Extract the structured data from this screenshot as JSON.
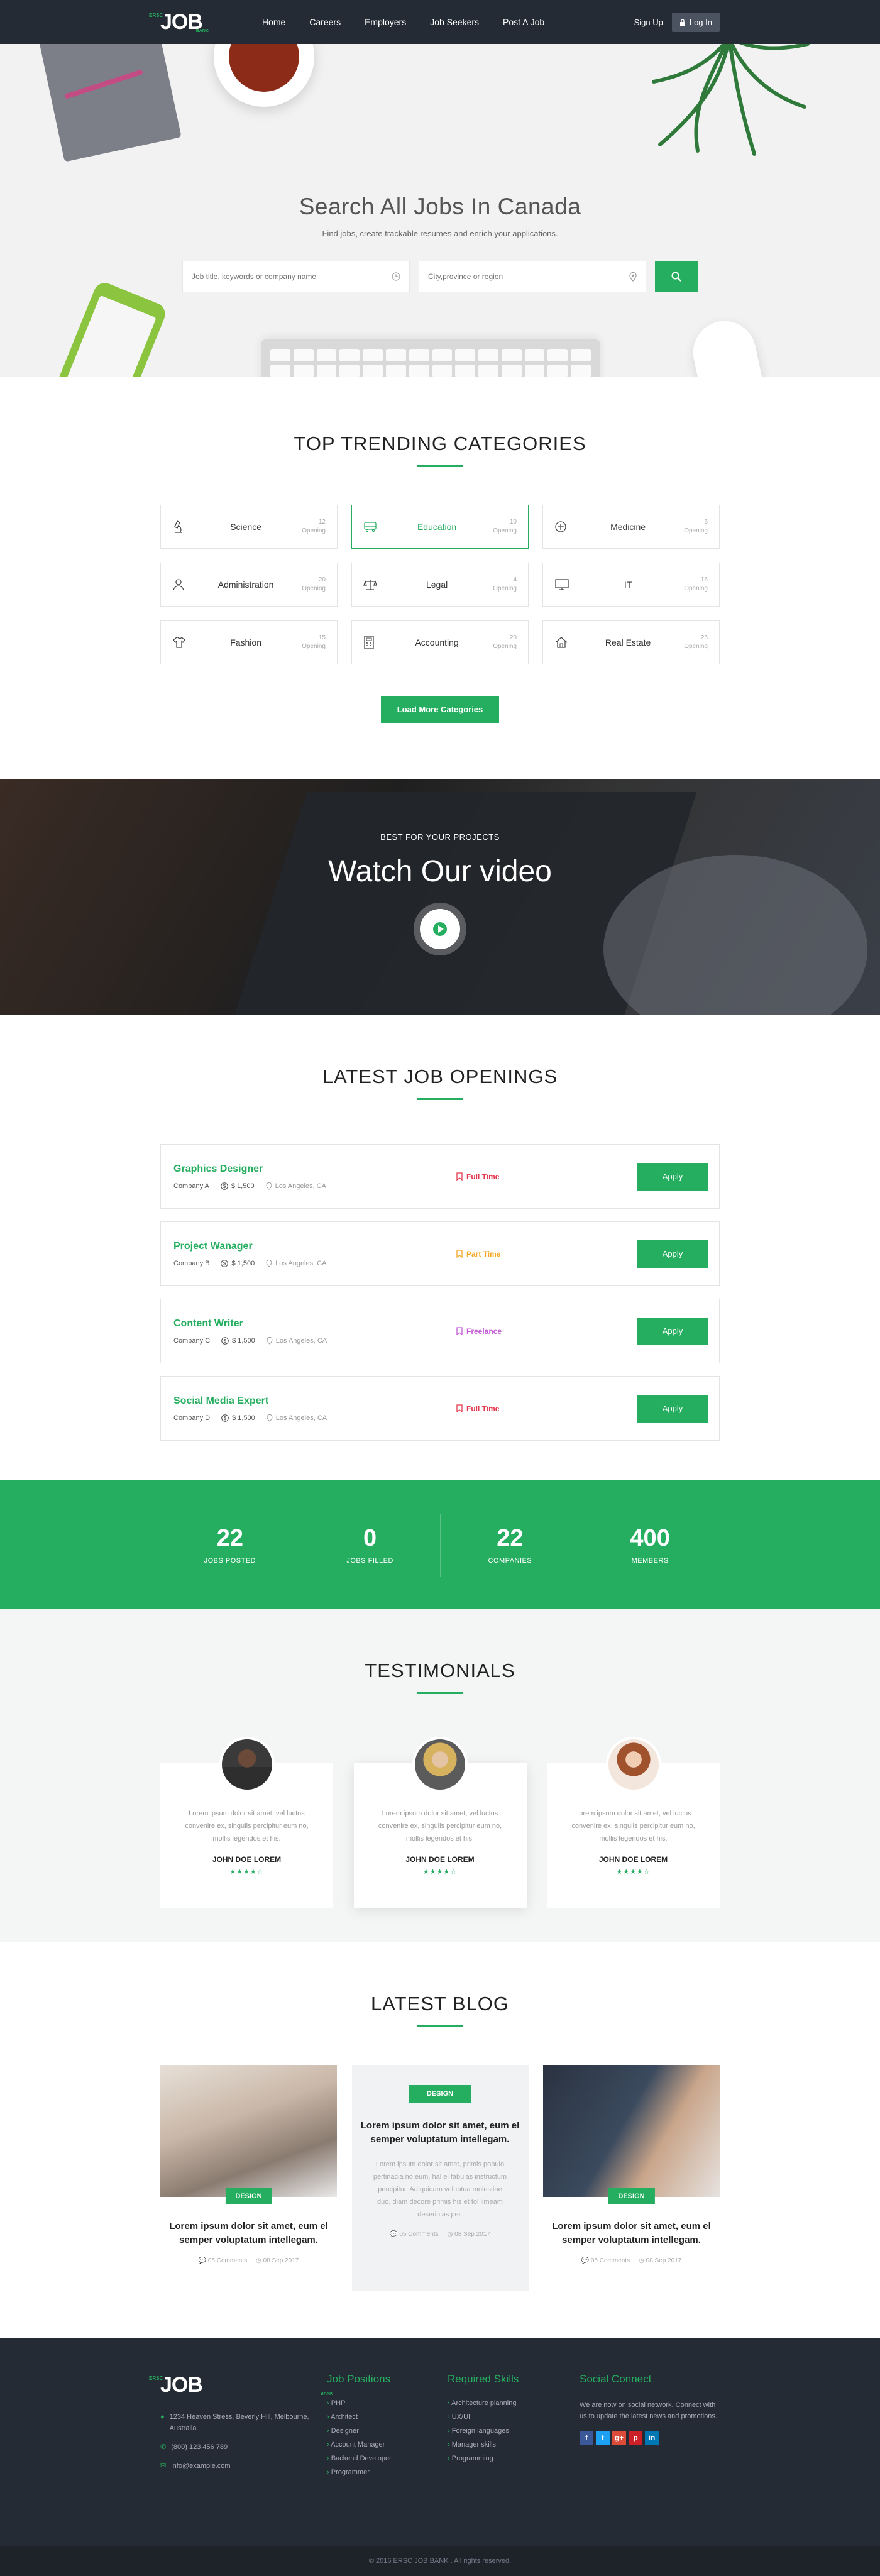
{
  "brand": {
    "logo_main": "JOB",
    "logo_small": "ERSC",
    "logo_sub": "BANK",
    "accent": "#25ae5f",
    "dark": "#252b34"
  },
  "nav": {
    "items": [
      "Home",
      "Careers",
      "Employers",
      "Job Seekers",
      "Post A Job"
    ],
    "signup": "Sign Up",
    "login": "Log In"
  },
  "hero": {
    "title": "Search All Jobs In Canada",
    "subtitle": "Find jobs, create trackable resumes and enrich your applications.",
    "keyword_placeholder": "Job title, keywords or company name",
    "location_placeholder": "City,province or region"
  },
  "categories": {
    "title": "TOP TRENDING CATEGORIES",
    "items": [
      {
        "name": "Science",
        "count": "12",
        "label": "Opening",
        "icon": "microscope-icon"
      },
      {
        "name": "Education",
        "count": "10",
        "label": "Opening",
        "icon": "bus-icon"
      },
      {
        "name": "Medicine",
        "count": "6",
        "label": "Opening",
        "icon": "medical-icon"
      },
      {
        "name": "Administration",
        "count": "20",
        "label": "Opening",
        "icon": "user-icon"
      },
      {
        "name": "Legal",
        "count": "4",
        "label": "Opening",
        "icon": "scale-icon"
      },
      {
        "name": "IT",
        "count": "16",
        "label": "Opening",
        "icon": "monitor-icon"
      },
      {
        "name": "Fashion",
        "count": "15",
        "label": "Opening",
        "icon": "shirt-icon"
      },
      {
        "name": "Accounting",
        "count": "20",
        "label": "Opening",
        "icon": "calculator-icon"
      },
      {
        "name": "Real Estate",
        "count": "26",
        "label": "Opening",
        "icon": "house-icon"
      }
    ],
    "button": "Load More Categories"
  },
  "video": {
    "kicker": "BEST FOR YOUR PROJECTS",
    "title": "Watch Our video"
  },
  "jobs": {
    "title": "LATEST JOB OPENINGS",
    "apply_label": "Apply",
    "items": [
      {
        "title": "Graphics Designer",
        "company": "Company A",
        "salary": "$ 1,500",
        "location": "Los Angeles, CA",
        "type": "Full Time",
        "type_color": "#e2384d"
      },
      {
        "title": "Project Wanager",
        "company": "Company B",
        "salary": "$ 1,500",
        "location": "Los Angeles, CA",
        "type": "Part Time",
        "type_color": "#f5a623"
      },
      {
        "title": "Content Writer",
        "company": "Company C",
        "salary": "$ 1,500",
        "location": "Los Angeles, CA",
        "type": "Freelance",
        "type_color": "#c45ad6"
      },
      {
        "title": "Social Media Expert",
        "company": "Company D",
        "salary": "$ 1,500",
        "location": "Los Angeles, CA",
        "type": "Full Time",
        "type_color": "#e2384d"
      }
    ]
  },
  "stats": [
    {
      "num": "22",
      "label": "JOBS POSTED"
    },
    {
      "num": "0",
      "label": "JOBS FILLED"
    },
    {
      "num": "22",
      "label": "COMPANIES"
    },
    {
      "num": "400",
      "label": "MEMBERS"
    }
  ],
  "testimonials": {
    "title": "TESTIMONIALS",
    "items": [
      {
        "text": "Lorem ipsum dolor sit amet, vel luctus convenire ex, singulis percipitur eum no, mollis legendos et his.",
        "name": "JOHN DOE LOREM",
        "stars": "★★★★☆"
      },
      {
        "text": "Lorem ipsum dolor sit amet, vel luctus convenire ex, singulis percipitur eum no, mollis legendos et his.",
        "name": "JOHN DOE LOREM",
        "stars": "★★★★☆"
      },
      {
        "text": "Lorem ipsum dolor sit amet, vel luctus convenire ex, singulis percipitur eum no, mollis legendos et his.",
        "name": "JOHN DOE LOREM",
        "stars": "★★★★☆"
      }
    ]
  },
  "blog": {
    "title": "LATEST BLOG",
    "posts": [
      {
        "tag": "DESIGN",
        "title": "Lorem ipsum dolor sit amet, eum el semper voluptatum intellegam.",
        "comments": "05 Comments",
        "date": "08 Sep 2017"
      },
      {
        "tag": "DESIGN",
        "title": "Lorem ipsum dolor sit amet, eum el semper voluptatum intellegam.",
        "text": "Lorem ipsum dolor sit amet, primis populo pertinacia no eum, hal ei fabulas instructum percipitur. Ad quidam voluptua molestiae duo, diam decore primis his et tol limeam deseriulas per.",
        "comments": "05 Comments",
        "date": "08 Sep 2017"
      },
      {
        "tag": "DESIGN",
        "title": "Lorem ipsum dolor sit amet, eum el semper voluptatum intellegam.",
        "comments": "05 Comments",
        "date": "08 Sep 2017"
      }
    ]
  },
  "footer": {
    "address": "1234 Heaven Stress, Beverly Hill, Melbourne, Australia.",
    "phone": "(800) 123 456 789",
    "email": "info@example.com",
    "positions_title": "Job Positions",
    "positions": [
      "PHP",
      "Architect",
      "Designer",
      "Account Manager",
      "Backend Developer",
      "Programmer"
    ],
    "skills_title": "Required Skills",
    "skills": [
      "Architecture planning",
      "UX/UI",
      "Foreign languages",
      "Manager skills",
      "Programming"
    ],
    "social_title": "Social Connect",
    "social_text": "We are now on social network. Connect with us to update the latest news and promotions.",
    "social_icons": [
      "f",
      "t",
      "g+",
      "p",
      "in"
    ],
    "copyright": "© 2016 ERSC JOB BANK . All rights reserved."
  }
}
